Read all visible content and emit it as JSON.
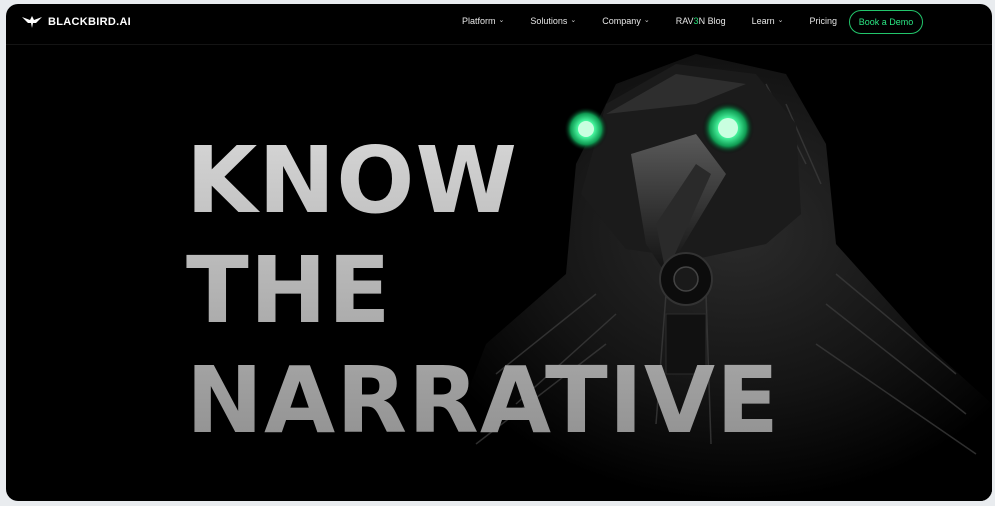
{
  "brand": {
    "name": "BLACKBIRD.AI",
    "logo_icon": "bird-logo-icon"
  },
  "nav": {
    "items": [
      {
        "label": "Platform",
        "has_dropdown": true
      },
      {
        "label": "Solutions",
        "has_dropdown": true
      },
      {
        "label": "Company",
        "has_dropdown": true
      },
      {
        "label_prefix": "RAV",
        "label_highlight": "3",
        "label_suffix": "N Blog",
        "has_dropdown": false
      },
      {
        "label": "Learn",
        "has_dropdown": true
      },
      {
        "label": "Pricing",
        "has_dropdown": false
      }
    ],
    "cta_label": "Book a Demo"
  },
  "hero": {
    "headline_lines": [
      "KNOW",
      "THE",
      "NARRATIVE"
    ]
  },
  "colors": {
    "background": "#000000",
    "accent_green": "#2be784",
    "headline_gray": "#bdbdbd"
  }
}
